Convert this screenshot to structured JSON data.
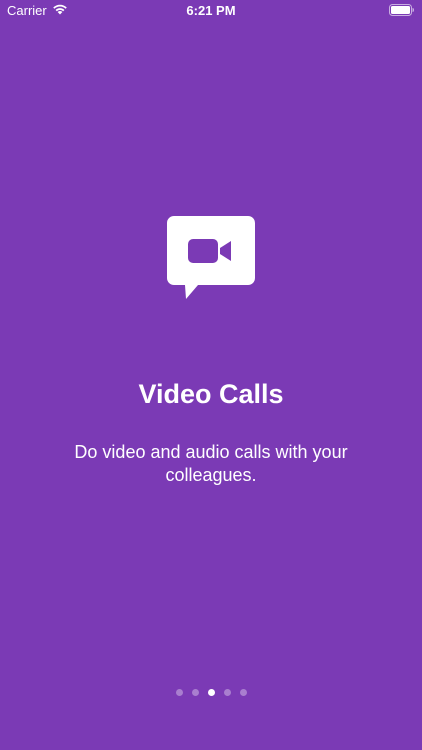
{
  "status_bar": {
    "carrier": "Carrier",
    "time": "6:21 PM"
  },
  "onboarding": {
    "icon": "video-chat-bubble-icon",
    "title": "Video Calls",
    "description": "Do video and audio calls with your colleagues."
  },
  "page_control": {
    "total_pages": 5,
    "current_page": 3
  },
  "colors": {
    "background": "#7B3AB5",
    "foreground": "#FFFFFF"
  }
}
